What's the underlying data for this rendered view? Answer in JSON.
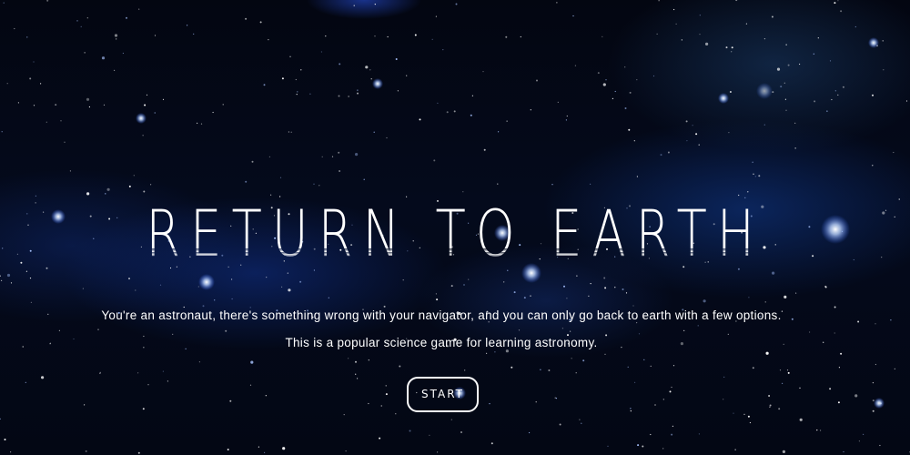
{
  "game": {
    "title": "RETURN TO EARTH",
    "description_line1": "You're an astronaut, there's something wrong with your navigator, and you can only go back to earth with a few options.",
    "description_line2": "This is a popular science game for learning astronomy.",
    "start_label": "START"
  },
  "colors": {
    "background": "#02040c",
    "nebula": "#1a46a8",
    "text": "#ffffff"
  }
}
